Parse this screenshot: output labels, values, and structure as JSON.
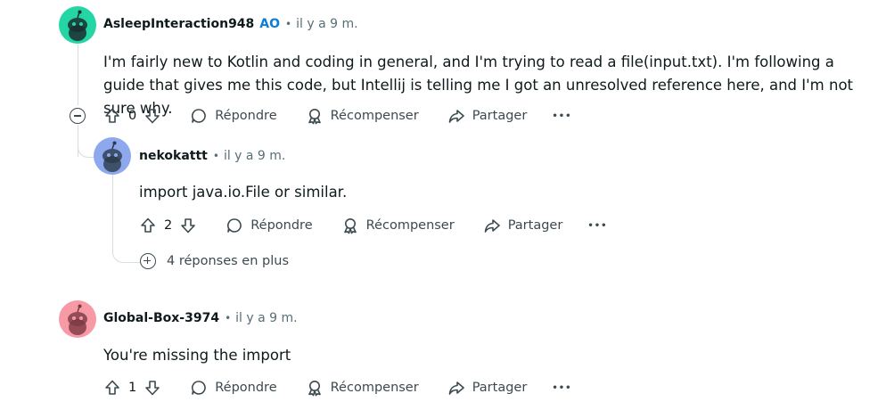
{
  "comments": [
    {
      "author": "AsleepInteraction948",
      "op_badge": "AO",
      "separator": "•",
      "time": "il y a 9 m.",
      "avatar_color": "#24d6a4",
      "text": "I'm fairly new to Kotlin and coding in general, and I'm trying to read a file(input.txt). I'm following a guide that gives me this code, but Intellij is telling me I got an unresolved reference here, and I'm not sure why.",
      "score": "0",
      "reply_label": "Répondre",
      "award_label": "Récompenser",
      "share_label": "Partager",
      "more_label": "•••"
    },
    {
      "author": "nekokattt",
      "separator": "•",
      "time": "il y a 9 m.",
      "avatar_color": "#8ea8ee",
      "text": "import java.io.File or similar.",
      "score": "2",
      "reply_label": "Répondre",
      "award_label": "Récompenser",
      "share_label": "Partager",
      "more_label": "•••",
      "more_replies": "4 réponses en plus"
    },
    {
      "author": "Global-Box-3974",
      "separator": "•",
      "time": "il y a 9 m.",
      "avatar_color": "#f79aa6",
      "text": "You're missing the import",
      "score": "1",
      "reply_label": "Répondre",
      "award_label": "Récompenser",
      "share_label": "Partager",
      "more_label": "•••"
    }
  ],
  "icons": {
    "upvote": "upvote-arrow-icon",
    "downvote": "downvote-arrow-icon",
    "reply": "speech-bubble-icon",
    "award": "award-ribbon-icon",
    "share": "share-arrow-icon",
    "collapse": "minus-circle-icon",
    "expand": "plus-circle-icon"
  }
}
